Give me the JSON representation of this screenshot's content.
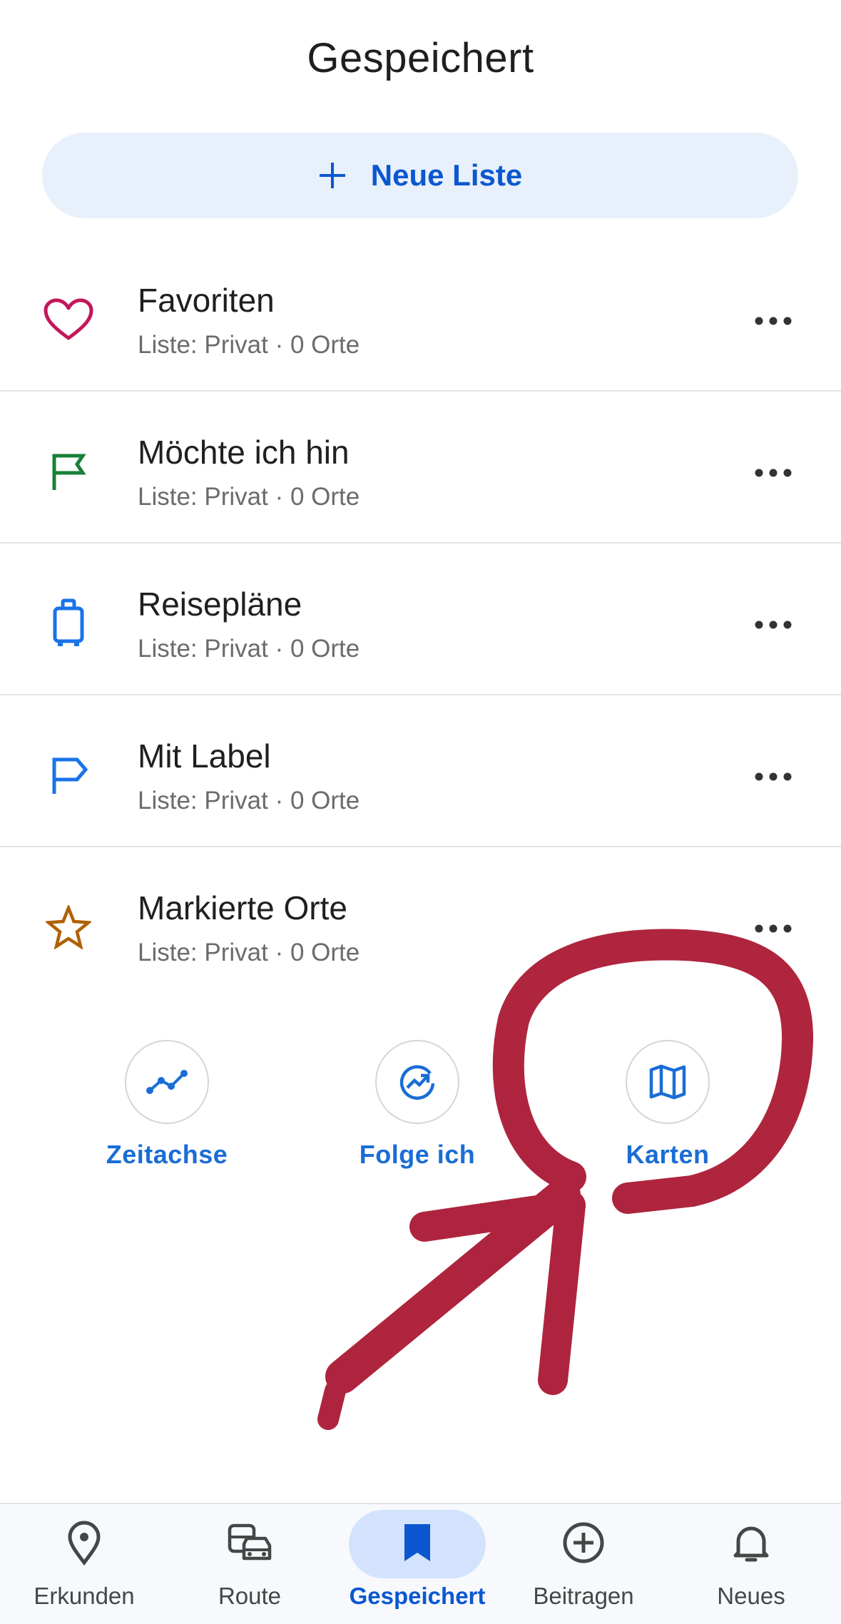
{
  "header": {
    "title": "Gespeichert"
  },
  "new_list": {
    "label": "Neue Liste",
    "icon": "plus-icon"
  },
  "lists": [
    {
      "title": "Favoriten",
      "subtitle": "Liste: Privat · 0 Orte",
      "icon": "heart-icon",
      "color": "#c2185b"
    },
    {
      "title": "Möchte ich hin",
      "subtitle": "Liste: Privat · 0 Orte",
      "icon": "flag-icon",
      "color": "#188038"
    },
    {
      "title": "Reisepläne",
      "subtitle": "Liste: Privat · 0 Orte",
      "icon": "suitcase-icon",
      "color": "#1a73e8"
    },
    {
      "title": "Mit Label",
      "subtitle": "Liste: Privat · 0 Orte",
      "icon": "label-icon",
      "color": "#1a73e8"
    },
    {
      "title": "Markierte Orte",
      "subtitle": "Liste: Privat · 0 Orte",
      "icon": "star-icon",
      "color": "#b06000"
    }
  ],
  "quick_actions": [
    {
      "label": "Zeitachse",
      "icon": "timeline-icon"
    },
    {
      "label": "Folge ich",
      "icon": "following-icon"
    },
    {
      "label": "Karten",
      "icon": "map-icon"
    }
  ],
  "bottom_nav": [
    {
      "label": "Erkunden",
      "icon": "location-pin-icon",
      "active": false
    },
    {
      "label": "Route",
      "icon": "commute-icon",
      "active": false
    },
    {
      "label": "Gespeichert",
      "icon": "bookmark-icon",
      "active": true
    },
    {
      "label": "Beitragen",
      "icon": "add-circle-icon",
      "active": false
    },
    {
      "label": "Neues",
      "icon": "bell-icon",
      "active": false
    }
  ],
  "colors": {
    "accent": "#0b57d0",
    "annotation": "#a8122e"
  }
}
